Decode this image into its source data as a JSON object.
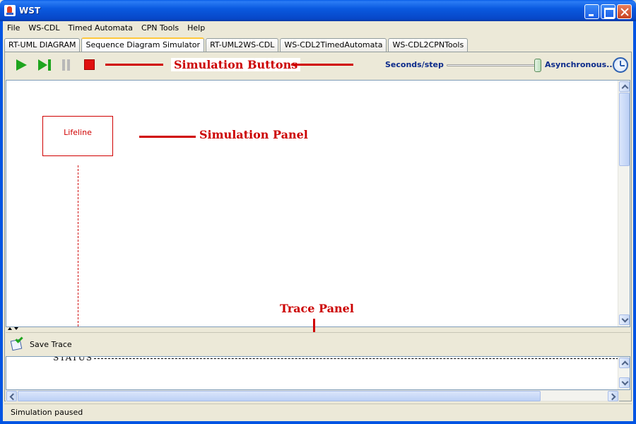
{
  "window": {
    "title": "WST"
  },
  "menu": [
    "File",
    "WS-CDL",
    "Timed Automata",
    "CPN Tools",
    "Help"
  ],
  "tabs": [
    {
      "label": "RT-UML DIAGRAM",
      "active": false
    },
    {
      "label": "Sequence Diagram Simulator",
      "active": true
    },
    {
      "label": "RT-UML2WS-CDL",
      "active": false
    },
    {
      "label": "WS-CDL2TimedAutomata",
      "active": false
    },
    {
      "label": "WS-CDL2CPNTools",
      "active": false
    }
  ],
  "toolbar": {
    "speed_label": "Seconds/step",
    "mode_label": "Asynchronous...",
    "speed_slider_fraction": 1.0
  },
  "annotations": {
    "simulation_buttons": "Simulation Buttons",
    "simulation_panel": "Simulation Panel",
    "trace_panel": "Trace Panel"
  },
  "simulation": {
    "lifeline_label": "Lifeline"
  },
  "trace": {
    "save_label": "Save Trace",
    "text": "STATUS"
  },
  "status": {
    "text": "Simulation paused"
  },
  "colors": {
    "annotation": "#cc0000",
    "label_blue": "#0b2a8a",
    "play_green": "#1ea51e",
    "stop_red": "#e01010"
  },
  "icons": [
    "play-icon",
    "step-icon",
    "pause-icon",
    "stop-icon",
    "clock-icon",
    "save-trace-icon"
  ]
}
